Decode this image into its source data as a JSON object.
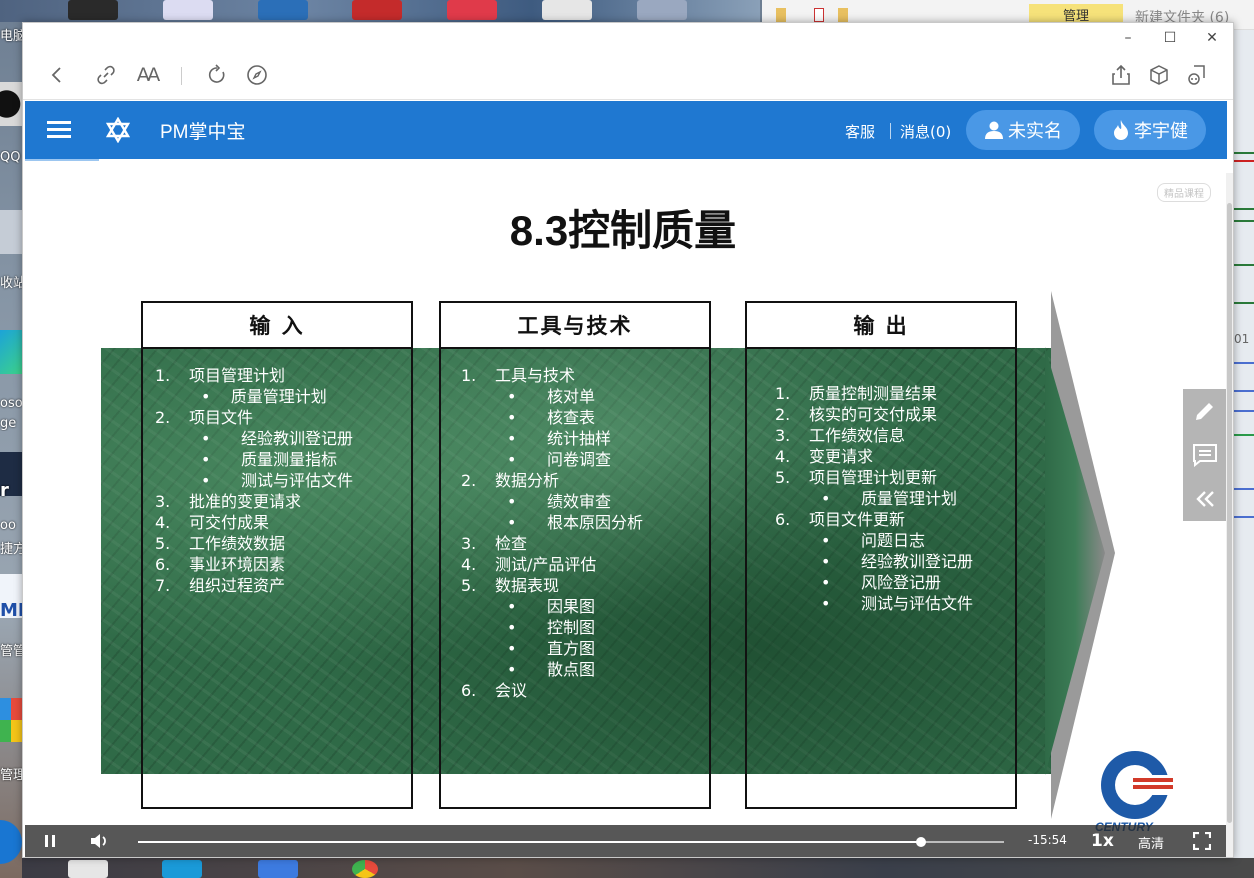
{
  "desktop": {
    "left_labels": [
      "电脑",
      "QQ",
      "收站",
      "oso",
      "ge",
      "r",
      "oo",
      "捷方",
      "MI",
      "管管",
      "管理"
    ],
    "explorer": {
      "manage_label": "管理",
      "folder_title": "新建文件夹 (6)"
    },
    "right_label": "01"
  },
  "window": {
    "controls": {
      "minimize": "–",
      "maximize": "☐",
      "close": "✕"
    }
  },
  "toolbar": {
    "icons": [
      "back-icon",
      "link-icon",
      "text-size-icon",
      "refresh-icon",
      "compass-icon",
      "share-icon",
      "cube-icon",
      "screenshot-icon"
    ],
    "text_size_label": "AA"
  },
  "app": {
    "title": "PM掌中宝",
    "customer_service": "客服",
    "messages": "消息(0)",
    "realname_button": "未实名",
    "user_button": "李宇健",
    "colors": {
      "header": "#1f78d1",
      "pill": "#4a98e6"
    }
  },
  "slide": {
    "title": "8.3控制质量",
    "watermark": "精品课程",
    "columns": [
      {
        "header": "输  入",
        "items": [
          {
            "num": "1.",
            "text": "项目管理计划",
            "subs": [
              "质量管理计划"
            ]
          },
          {
            "num": "2.",
            "text": "项目文件",
            "subs": [
              "经验教训登记册",
              "质量测量指标",
              "测试与评估文件"
            ]
          },
          {
            "num": "3.",
            "text": "批准的变更请求",
            "subs": []
          },
          {
            "num": "4.",
            "text": "可交付成果",
            "subs": []
          },
          {
            "num": "5.",
            "text": "工作绩效数据",
            "subs": []
          },
          {
            "num": "6.",
            "text": "事业环境因素",
            "subs": []
          },
          {
            "num": "7.",
            "text": "组织过程资产",
            "subs": []
          }
        ]
      },
      {
        "header": "工具与技术",
        "items": [
          {
            "num": "1.",
            "text": "工具与技术",
            "subs": [
              "核对单",
              "核查表",
              "统计抽样",
              "问卷调查"
            ]
          },
          {
            "num": "2.",
            "text": "数据分析",
            "subs": [
              "绩效审查",
              "根本原因分析"
            ]
          },
          {
            "num": "3.",
            "text": "检查",
            "subs": []
          },
          {
            "num": "4.",
            "text": "测试/产品评估",
            "subs": []
          },
          {
            "num": "5.",
            "text": "数据表现",
            "subs": [
              "因果图",
              "控制图",
              "直方图",
              "散点图"
            ]
          },
          {
            "num": "6.",
            "text": "会议",
            "subs": []
          }
        ]
      },
      {
        "header": "输  出",
        "items": [
          {
            "num": "1.",
            "text": "质量控制测量结果",
            "subs": []
          },
          {
            "num": "2.",
            "text": "核实的可交付成果",
            "subs": []
          },
          {
            "num": "3.",
            "text": "工作绩效信息",
            "subs": []
          },
          {
            "num": "4.",
            "text": "变更请求",
            "subs": []
          },
          {
            "num": "5.",
            "text": "项目管理计划更新",
            "subs": [
              "质量管理计划"
            ]
          },
          {
            "num": "6.",
            "text": "项目文件更新",
            "subs": [
              "问题日志",
              "经验教训登记册",
              "风险登记册",
              "测试与评估文件"
            ]
          }
        ]
      }
    ],
    "logo_text": "CENTURY"
  },
  "player": {
    "time_remaining": "-15:54",
    "speed": "1x",
    "quality": "高清",
    "progress_fraction": 0.904
  },
  "side_panel": {
    "icons": [
      "pencil-icon",
      "comment-icon",
      "collapse-icon"
    ]
  }
}
